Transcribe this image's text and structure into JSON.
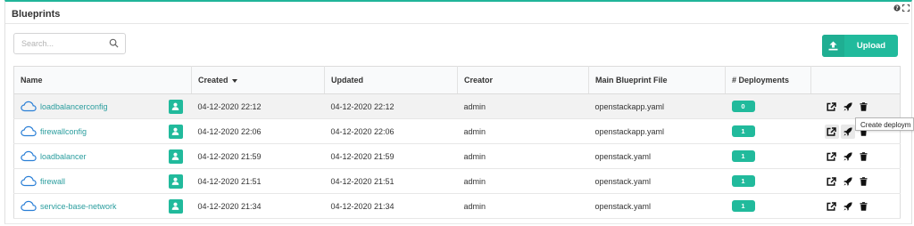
{
  "widget": {
    "title": "Blueprints",
    "help_icon": "help-circle-icon",
    "expand_icon": "expand-icon"
  },
  "search": {
    "placeholder": "Search...",
    "value": "",
    "icon": "search-icon"
  },
  "upload_button": {
    "label": "Upload",
    "icon": "upload-icon",
    "color": "#21ba9c"
  },
  "table": {
    "columns": [
      "Name",
      "Created",
      "Updated",
      "Creator",
      "Main Blueprint File",
      "# Deployments"
    ],
    "sorted_column": "Created",
    "sort_direction": "descending",
    "rows": [
      {
        "name": "loadbalancerconfig",
        "created": "04-12-2020 22:12",
        "updated": "04-12-2020 22:12",
        "creator": "admin",
        "main_file": "openstackapp.yaml",
        "deployments": "0"
      },
      {
        "name": "firewallconfig",
        "created": "04-12-2020 22:06",
        "updated": "04-12-2020 22:06",
        "creator": "admin",
        "main_file": "openstackapp.yaml",
        "deployments": "1"
      },
      {
        "name": "loadbalancer",
        "created": "04-12-2020 21:59",
        "updated": "04-12-2020 21:59",
        "creator": "admin",
        "main_file": "openstack.yaml",
        "deployments": "1"
      },
      {
        "name": "firewall",
        "created": "04-12-2020 21:51",
        "updated": "04-12-2020 21:51",
        "creator": "admin",
        "main_file": "openstack.yaml",
        "deployments": "1"
      },
      {
        "name": "service-base-network",
        "created": "04-12-2020 21:34",
        "updated": "04-12-2020 21:34",
        "creator": "admin",
        "main_file": "openstack.yaml",
        "deployments": "1"
      }
    ],
    "row_icons": {
      "blueprint": "cloud-icon",
      "creator": "user-icon",
      "actions": [
        "share-icon",
        "rocket-icon",
        "trash-icon"
      ]
    }
  },
  "tooltip": {
    "text": "Create deploym"
  },
  "colors": {
    "accent": "#21ba9c",
    "link": "#2a9d9e",
    "selected_row": "#f2f2f2"
  }
}
